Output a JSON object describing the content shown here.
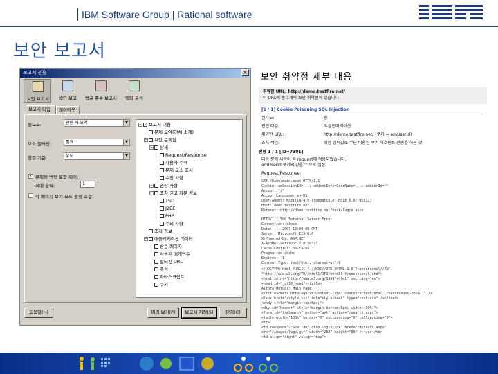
{
  "header": {
    "group_text": "IBM Software Group | Rational software",
    "logo_text": "IBM",
    "page_title": "보안 보고서"
  },
  "dialog": {
    "title": "보고서 선정",
    "toolbar": [
      {
        "label": "보안 보고서",
        "icon": "report-icon"
      },
      {
        "label": "색인 보고",
        "icon": "index-icon"
      },
      {
        "label": "법규 준수 보고서",
        "icon": "compliance-icon"
      },
      {
        "label": "델타 분석",
        "icon": "delta-icon"
      }
    ],
    "tabs": [
      "보고서 타입",
      "레이아웃"
    ],
    "fields": {
      "importance_label": "중요도:",
      "importance_value": "관련 자 요약",
      "issue_filter_label": "요소 필터링:",
      "issue_filter_value": "필요",
      "sort_label": "정렬 기준:",
      "sort_value": "우도",
      "include_variants_label": "문제점 변형 포함 제어:",
      "max_count_label": "최대 출력:",
      "max_count_value": "1",
      "extra_label": "각 페이지 보기 모드 활성 포함"
    },
    "tree": [
      {
        "label": "보고서 내용",
        "level": 0,
        "expander": "−",
        "checked": true
      },
      {
        "label": "문제 요약(간체 소개)",
        "level": 1,
        "expander": "",
        "checked": false
      },
      {
        "label": "보안 문제점",
        "level": 1,
        "expander": "−",
        "checked": false
      },
      {
        "label": "상세",
        "level": 2,
        "expander": "−",
        "checked": false
      },
      {
        "label": "Request/Response",
        "level": 3,
        "expander": "",
        "checked": false
      },
      {
        "label": "사용자 주석",
        "level": 3,
        "expander": "",
        "checked": false
      },
      {
        "label": "문제 요소 표시",
        "level": 3,
        "expander": "",
        "checked": false
      },
      {
        "label": "수정 사항",
        "level": 3,
        "expander": "",
        "checked": false
      },
      {
        "label": "권장 사항",
        "level": 2,
        "expander": "−",
        "checked": false
      },
      {
        "label": "조치 권고 자문 정보",
        "level": 2,
        "expander": "−",
        "checked": false
      },
      {
        "label": "TSD",
        "level": 3,
        "expander": "",
        "checked": false
      },
      {
        "label": "J2EE",
        "level": 3,
        "expander": "",
        "checked": false
      },
      {
        "label": "PHP",
        "level": 3,
        "expander": "",
        "checked": false
      },
      {
        "label": "주의 사항",
        "level": 3,
        "expander": "",
        "checked": false
      },
      {
        "label": "조치 정보",
        "level": 1,
        "expander": "",
        "checked": false
      },
      {
        "label": "애플리케이션 데이터",
        "level": 1,
        "expander": "−",
        "checked": false
      },
      {
        "label": "방문 페이지",
        "level": 2,
        "expander": "",
        "checked": false
      },
      {
        "label": "사용된 매개변수",
        "level": 2,
        "expander": "",
        "checked": false
      },
      {
        "label": "필터된 URL",
        "level": 2,
        "expander": "",
        "checked": false
      },
      {
        "label": "주석",
        "level": 2,
        "expander": "",
        "checked": false
      },
      {
        "label": "자바스크립트",
        "level": 2,
        "expander": "",
        "checked": false
      },
      {
        "label": "쿠키",
        "level": 2,
        "expander": "",
        "checked": false
      }
    ],
    "buttons": {
      "help": "도움말(H)",
      "preview": "미리 보기(P)",
      "save": "보고서 저장(S)",
      "close": "닫기(C)"
    }
  },
  "document": {
    "title": "보안 취약점 세부 내용",
    "box_line1": "취약한 URL: http://demo.testfire.net/",
    "box_line2": "이 URL에 총 1개의 보안 취약점이 있습니다.",
    "issue_heading": "[1 / 1]  Cookie Poisoning SQL Injection",
    "rows": [
      {
        "k": "심각도:",
        "v": "중"
      },
      {
        "k": "관련 타입:",
        "v": "3-클린매게이션"
      },
      {
        "k": "취약한 URL:",
        "v": "http://demo.testfire.net/ (쿠키 = amUserId)"
      },
      {
        "k": "조치 작업:",
        "v": "위험 입력값로 무단 비용된 쿠키 익스텐트 전송을 하는 것"
      }
    ],
    "variant_heading": "변형 1 / 1  [ID=7301]",
    "variant_line1": "다음 문제 사항이 원 request에 적용되었습니다.",
    "variant_line2": "amUserId 쿠키의 값을 '\"'으로 설정",
    "request_label": "Request/Response:",
    "request_lines": [
      "GET /bank/main.aspx HTTP/1.1",
      "Cookie: amSessionId=...; amUserInfo=UserName=...; amUserId='\"",
      "Accept: */*",
      "Accept-Language: en-US",
      "User-Agent: Mozilla/4.0 (compatible; MSIE 6.0; Win32)",
      "Host: demo.testfire.net",
      "Referer: http://demo.testfire.net/bank/login.aspx"
    ],
    "response_lines": [
      "HTTP/1.1 500 Internal Server Error",
      "Connection: close",
      "Date: ... 2007 12:00:00 GMT",
      "Server: Microsoft-IIS/6.0",
      "X-Powered-By: ASP.NET",
      "X-AspNet-Version: 2.0.50727",
      "Cache-Control: no-cache",
      "Pragma: no-cache",
      "Expires: -1",
      "Content-Type: text/html; charset=utf-8"
    ],
    "html_lines": [
      "<!DOCTYPE html PUBLIC \"-//W3C//DTD XHTML 1.0 Transitional//EN\"",
      "\"http://www.w3.org/TR/xhtml1/DTD/xhtml1-transitional.dtd\">",
      "<html xmlns=\"http://www.w3.org/1999/xhtml\" xml:lang=\"en\">",
      "<head id=\"_ctl0_head\"><title>",
      "  Altoro Mutual: Main Page",
      "</title><meta http-equiv=\"Content-Type\" content=\"text/html; charset=iso-8859-1\" />",
      "<link href=\"/style.css\" rel=\"stylesheet\" type=\"text/css\" /></head>",
      "<body style=\"margin-top:5px;\">",
      "<div id=\"header\" style=\"margin-bottom:5px; width: 99%;\">",
      "  <form id=\"frmSearch\" method=\"get\" action=\"/search.aspx\">",
      "  <table width=\"100%\" border=\"0\" cellpadding=\"0\" cellspacing=\"0\">",
      "    <tr>",
      "      <td rowspan=\"2\"><a id=\"_ctl0_LoginLink\" href=\"/default.aspx\"",
      "      src=\"/images/logo.gif\" width=\"283\" height=\"80\" /></a></td>",
      "      <td align=\"right\" valign=\"top\">"
    ]
  },
  "footer": {
    "decor": [
      "people-figures",
      "grid-graphic",
      "cyclist-figures"
    ]
  }
}
